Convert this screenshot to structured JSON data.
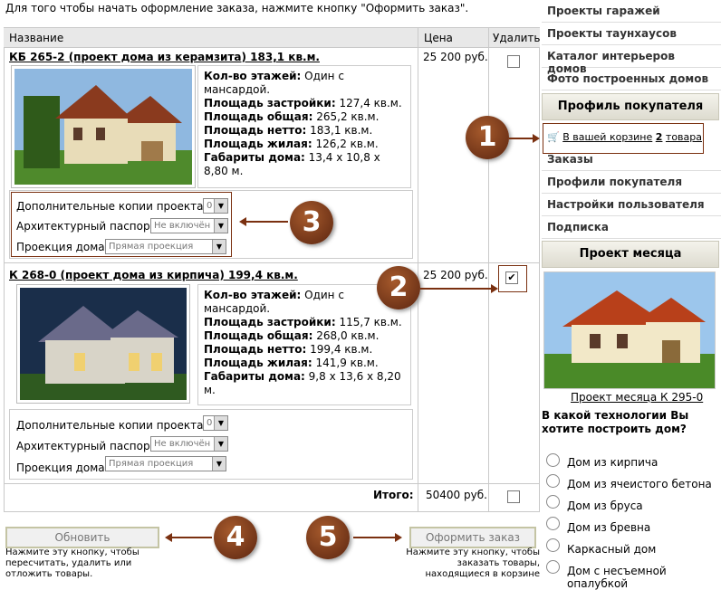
{
  "intro": "Для того чтобы начать оформление заказа, нажмите кнопку \"Оформить заказ\".",
  "table": {
    "col_name": "Название",
    "col_price": "Цена",
    "col_delete": "Удалить",
    "total_label": "Итого:",
    "total_value": "50400 руб."
  },
  "products": [
    {
      "title": "КБ 265-2 (проект дома из керамзита) 183,1 кв.м.",
      "price": "25 200 руб.",
      "checked": false,
      "specs": [
        {
          "label": "Кол-во этажей:",
          "value": "Один с мансардой."
        },
        {
          "label": "Площадь застройки:",
          "value": "127,4 кв.м."
        },
        {
          "label": "Площадь общая:",
          "value": "265,2 кв.м."
        },
        {
          "label": "Площадь нетто:",
          "value": "183,1 кв.м."
        },
        {
          "label": "Площадь жилая:",
          "value": "126,2 кв.м."
        },
        {
          "label": "Габариты дома:",
          "value": "13,4 x 10,8 x 8,80 м."
        }
      ],
      "opt_copies_label": "Дополнительные копии проекта:",
      "opt_copies_value": "0",
      "opt_passport_label": "Архитектурный паспорт:",
      "opt_passport_value": "Не включён",
      "opt_projection_label": "Проекция дома:",
      "opt_projection_value": "Прямая проекция"
    },
    {
      "title": "К 268-0 (проект дома из кирпича) 199,4 кв.м.",
      "price": "25 200 руб.",
      "checked": true,
      "specs": [
        {
          "label": "Кол-во этажей:",
          "value": "Один с мансардой."
        },
        {
          "label": "Площадь застройки:",
          "value": "115,7 кв.м."
        },
        {
          "label": "Площадь общая:",
          "value": "268,0 кв.м."
        },
        {
          "label": "Площадь нетто:",
          "value": "199,4 кв.м."
        },
        {
          "label": "Площадь жилая:",
          "value": "141,9 кв.м."
        },
        {
          "label": "Габариты дома:",
          "value": "9,8 x 13,6 x 8,20 м."
        }
      ],
      "opt_copies_label": "Дополнительные копии проекта:",
      "opt_copies_value": "0",
      "opt_passport_label": "Архитектурный паспорт:",
      "opt_passport_value": "Не включён",
      "opt_projection_label": "Проекция дома:",
      "opt_projection_value": "Прямая проекция"
    }
  ],
  "buttons": {
    "update_label": "Обновить",
    "update_hint": "Нажмите эту кнопку, чтобы пересчитать, удалить или отложить товары.",
    "checkout_label": "Оформить заказ",
    "checkout_hint": "Нажмите эту кнопку, чтобы заказать товары, находящиеся в корзине"
  },
  "badges": [
    "1",
    "2",
    "3",
    "4",
    "5"
  ],
  "sidebar": {
    "top_items": [
      "Проекты гаражей",
      "Проекты таунхаусов",
      "Каталог интерьеров домов",
      "Фото построенных домов"
    ],
    "profile_header": "Профиль покупателя",
    "cart_link_prefix": "В вашей корзине",
    "cart_count": "2",
    "cart_link_suffix": "товара",
    "profile_items": [
      "Заказы",
      "Профили покупателя",
      "Настройки пользователя",
      "Подписка"
    ],
    "month_header": "Проект месяца",
    "month_link": "Проект месяца К 295-0",
    "poll_question": "В какой технологии Вы хотите построить дом?",
    "poll_options": [
      "Дом из кирпича",
      "Дом из ячеистого бетона",
      "Дом из бруса",
      "Дом из бревна",
      "Каркасный дом",
      "Дом с несъемной опалубкой"
    ]
  },
  "colors": {
    "accent_brown": "#7a3010",
    "header_bg": "#e8e8e8"
  }
}
